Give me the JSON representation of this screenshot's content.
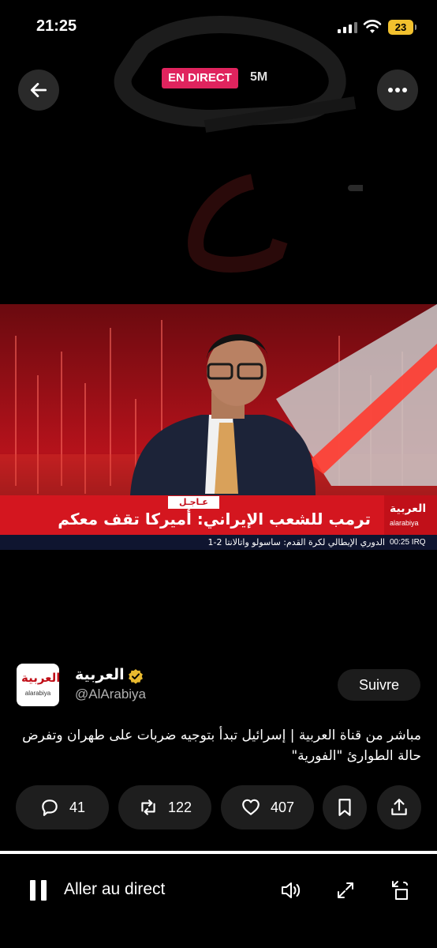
{
  "status_bar": {
    "time": "21:25",
    "battery": "23"
  },
  "live": {
    "badge": "EN DIRECT",
    "viewers": "5M"
  },
  "video": {
    "breaking_label": "عـاجـل",
    "headline": "ترمب للشعب الإيراني: أميركا تقف معكم",
    "subticker": "الدوري الإيطالي لكرة القدم: ساسولو واتالانتا 2-1",
    "clock": "00:25 IRQ",
    "logo_ar": "العربية",
    "logo_en": "alarabiya"
  },
  "tweet": {
    "avatar_ar": "العربية",
    "avatar_en": "alarabiya",
    "display_name": "العربية",
    "handle": "@AlArabiya",
    "follow_label": "Suivre",
    "text": "مباشر من قناة العربية | إسرائيل تبدأ بتوجيه ضربات على طهران وتفرض حالة الطوارئ \"الفورية\""
  },
  "actions": {
    "replies": "41",
    "reposts": "122",
    "likes": "407"
  },
  "player": {
    "go_live_label": "Aller au direct",
    "progress": 1.0
  },
  "icons": {
    "back": "arrow-left-icon",
    "more": "more-icon",
    "reply": "comment-icon",
    "repost": "repost-icon",
    "like": "heart-icon",
    "bookmark": "bookmark-icon",
    "share": "share-icon",
    "pause": "pause-icon",
    "volume": "volume-icon",
    "fullscreen": "expand-icon",
    "rotate": "rotate-icon"
  },
  "colors": {
    "live_badge": "#e0245e",
    "channel_red": "#d4161f",
    "verified": "#e8b92f"
  }
}
